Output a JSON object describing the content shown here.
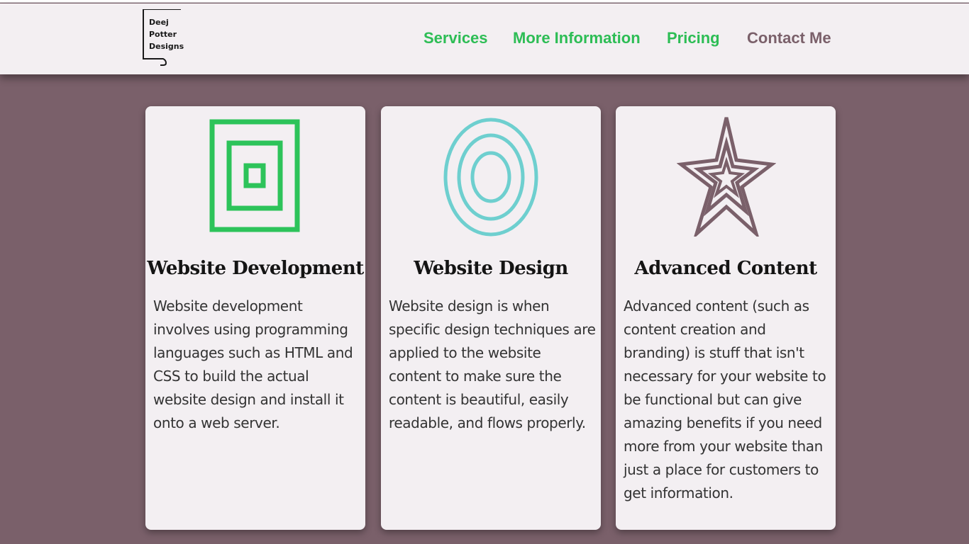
{
  "logo": {
    "lines": [
      "Deej",
      "Potter",
      "Designs"
    ]
  },
  "nav": {
    "items": [
      {
        "label": "Services",
        "color": "#2dbd55"
      },
      {
        "label": "More Information",
        "color": "#2dbd55"
      },
      {
        "label": "Pricing",
        "color": "#2dbd55"
      },
      {
        "label": "Contact Me",
        "color": "#7a606a"
      }
    ]
  },
  "colors": {
    "background": "#7a606a",
    "header": "#f3eff2",
    "green": "#2dc35a",
    "teal": "#6ecfcf",
    "mauve": "#7a606a"
  },
  "cards": [
    {
      "icon": "nested-squares-icon",
      "title": "Website Development",
      "text": "Website development involves using programming languages such as HTML and CSS to build the actual website design and install it onto a web server."
    },
    {
      "icon": "concentric-circles-icon",
      "title": "Website Design",
      "text": "Website design is when specific design techniques are applied to the website content to make sure the content is beautiful, easily readable, and flows properly."
    },
    {
      "icon": "nested-stars-icon",
      "title": "Advanced Content",
      "text": "Advanced content (such as content creation and branding) is stuff that isn't necessary for your website to be functional but can give amazing benefits if you need more from your website than just a place for customers to get information."
    }
  ]
}
